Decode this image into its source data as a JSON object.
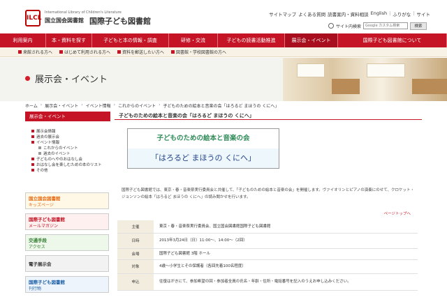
{
  "header": {
    "logo_mark": "ILCL",
    "logo_sub": "International Library of Children's Literature",
    "logo_main1": "国立国会図書館",
    "logo_main2": "国際子ども図書館",
    "utility_links": [
      "サイトマップ",
      "よくある質問",
      "読書案内・資料相談",
      "English",
      "|",
      "ふりがな",
      "|",
      "サイト"
    ],
    "search_label": "サイト内検索",
    "search_placeholder": "Google カスタム検索",
    "search_button": "検索"
  },
  "mainnav": [
    {
      "label": "利用案内",
      "active": false
    },
    {
      "label": "本・資料を探す",
      "active": false
    },
    {
      "label": "子どもと本の情報・調査",
      "active": false
    },
    {
      "label": "研修・交流",
      "active": false
    },
    {
      "label": "子どもの読書活動推進",
      "active": false
    },
    {
      "label": "展示会・イベント",
      "active": true
    },
    {
      "label": "国際子ども図書館について",
      "active": false
    }
  ],
  "subnav": [
    "来館される方へ",
    "はじめて利用される方へ",
    "資料を郵送したい方へ",
    "図書館・学校図書館の方へ"
  ],
  "page_title": "展示会・イベント",
  "breadcrumb": [
    "ホーム",
    "展示会・イベント",
    "イベント情報",
    "これからのイベント",
    "子どものための絵本と音楽の会「はろるど まほうの くにへ」"
  ],
  "sidebar": {
    "heading": "展示会・イベント",
    "items": [
      {
        "label": "展示会情報",
        "child": false
      },
      {
        "label": "過去の展示会",
        "child": false
      },
      {
        "label": "イベント情報",
        "child": false
      },
      {
        "label": "これからのイベント",
        "child": true
      },
      {
        "label": "過去のイベント",
        "child": true
      },
      {
        "label": "子どものへやのおはなし会",
        "child": false
      },
      {
        "label": "おはなし会を楽しむための本のリスト",
        "child": false
      },
      {
        "label": "その他",
        "child": false
      }
    ],
    "banners": [
      {
        "line1": "国立国会図書館",
        "line2": "キッズページ"
      },
      {
        "line1": "国際子ども図書館",
        "line2": "メールマガジン"
      },
      {
        "line1": "交通手段",
        "line2": "アクセス"
      },
      {
        "line1": "電子展示会",
        "line2": ""
      },
      {
        "line1": "国際子ども図書館",
        "line2": "刊行物"
      }
    ]
  },
  "content": {
    "title": "子どものための絵本と音楽の会「はろるど まほうの くにへ」",
    "poster_top": "子どものための絵本と音楽の会",
    "poster_band": "「はろるど まほうの くにへ」",
    "description": "国際子ども図書館では、東京・春・音楽祭実行委員会と共催して、「子どものための絵本と音楽の会」を開催します。ヴァイオリンとピアノの演奏にのせて、クロケット・ジョンソンの絵本「はろるど まほうの くにへ」の読み聞かせを行います。",
    "pagetop": "ページトップへ",
    "info_rows": [
      {
        "key": "主催",
        "value": "東京・春・音楽祭実行委員会、国立国会図書館国際子ども図書館"
      },
      {
        "key": "日時",
        "value": "2013年3月24日（日）11:00～、14:00～（2回）"
      },
      {
        "key": "会場",
        "value": "国際子ども図書館 3階 ホール"
      },
      {
        "key": "対象",
        "value": "4歳～小学生とその保護者（各回先着100名程度）"
      },
      {
        "key": "申込",
        "value": "往復はがきにて、参加希望の回・参加者全員の氏名・年齢・住所・電話番号を記入のうえお申し込みください。"
      }
    ]
  }
}
